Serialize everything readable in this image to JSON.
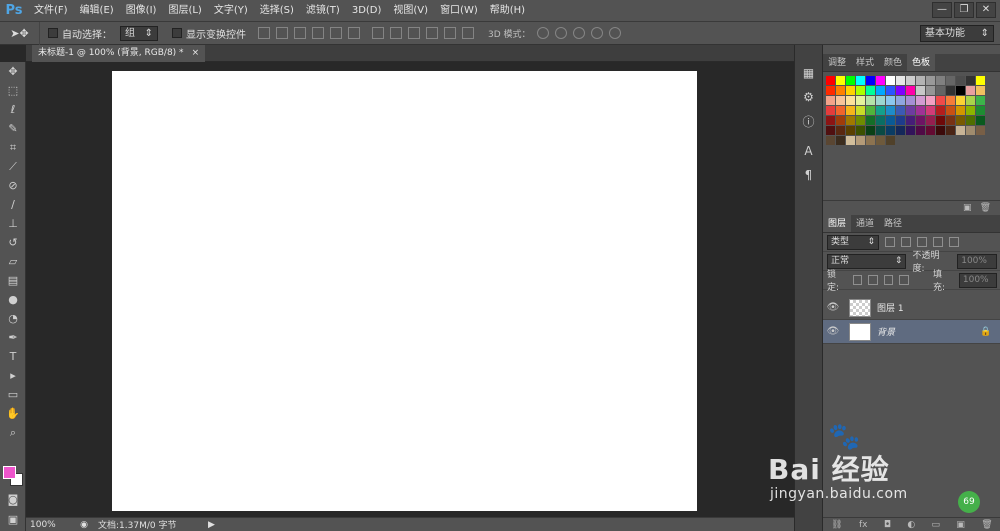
{
  "app": {
    "logo": "Ps"
  },
  "menu": [
    "文件(F)",
    "编辑(E)",
    "图像(I)",
    "图层(L)",
    "文字(Y)",
    "选择(S)",
    "滤镜(T)",
    "3D(D)",
    "视图(V)",
    "窗口(W)",
    "帮助(H)"
  ],
  "window_controls": {
    "minimize": "—",
    "restore": "❐",
    "close": "✕"
  },
  "options_bar": {
    "auto_select_label": "自动选择：",
    "auto_select_value": "组",
    "show_transform_label": "显示变换控件",
    "mode_3d_label": "3D 模式：",
    "workspace": "基本功能"
  },
  "document_tab": {
    "title": "未标题-1 @ 100% (背景, RGB/8) *",
    "close": "×"
  },
  "status_bar": {
    "zoom": "100%",
    "doc_info": "文档:1.37M/0 字节"
  },
  "top_panel": {
    "tabs": [
      "调整",
      "样式",
      "颜色",
      "色板"
    ],
    "active_tab": "色板",
    "swatch_colors": [
      "#ff0000",
      "#ffff00",
      "#00ff00",
      "#00ffff",
      "#0000ff",
      "#ff00ff",
      "#ffffff",
      "#e6e6e6",
      "#cccccc",
      "#b3b3b3",
      "#999999",
      "#808080",
      "#666666",
      "#4d4d4d",
      "#333333",
      "#ffff00",
      "#ff2a00",
      "#ff8000",
      "#ffd200",
      "#aaff00",
      "#00ff99",
      "#00a8ff",
      "#2a55ff",
      "#7f00ff",
      "#ff00aa",
      "#c8c8c8",
      "#969696",
      "#646464",
      "#323232",
      "#000000",
      "#e8a0a0",
      "#f0c060",
      "#f3a38a",
      "#f8c49a",
      "#fde19a",
      "#e6f39c",
      "#b4e3a8",
      "#9cd6d0",
      "#8cc7ee",
      "#8fa6e0",
      "#a68fd5",
      "#d39bd2",
      "#f2a0c3",
      "#f04a4a",
      "#f57c3a",
      "#fbd234",
      "#a8d44a",
      "#3cb44a",
      "#e43c3c",
      "#f0642c",
      "#f5b41a",
      "#c8dc28",
      "#50b43c",
      "#14a08c",
      "#1e8cc8",
      "#3c5ab4",
      "#6e3ca0",
      "#a03296",
      "#d23c78",
      "#b41e1e",
      "#c85014",
      "#d29600",
      "#8cb400",
      "#1e8c32",
      "#8c1414",
      "#a03c0a",
      "#a07800",
      "#6e8c00",
      "#146e28",
      "#0a6e64",
      "#0a5a96",
      "#1e3c8c",
      "#461e78",
      "#6e1464",
      "#961e50",
      "#6e0a0a",
      "#783214",
      "#785a00",
      "#506e00",
      "#0a5a1e",
      "#501010",
      "#5a2810",
      "#5a4000",
      "#3c5000",
      "#0a4016",
      "#0a4a44",
      "#0a3c64",
      "#14285a",
      "#32145a",
      "#500a46",
      "#640a32",
      "#3c0a0a",
      "#4a2414",
      "#c8b496",
      "#a08c6e",
      "#785f46",
      "#5a4632",
      "#3c2d1e",
      "#d2be9b",
      "#b49b78",
      "#8c7350",
      "#6e5a3c",
      "#50412a"
    ]
  },
  "layers_panel": {
    "tabs": [
      "图层",
      "通道",
      "路径"
    ],
    "active_tab": "图层",
    "filter_kind": "类型",
    "blend_mode": "正常",
    "opacity_label": "不透明度:",
    "opacity_value": "100%",
    "lock_label": "锁定:",
    "fill_label": "填充:",
    "fill_value": "100%",
    "layers": [
      {
        "name": "图层 1",
        "selected": false,
        "locked": false,
        "thumb": "checker"
      },
      {
        "name": "背景",
        "selected": true,
        "locked": true,
        "thumb": "white"
      }
    ]
  },
  "foreground_color": "#ee55cc",
  "background_color": "#ffffff",
  "watermark": {
    "brand": "Bai  经验",
    "url": "jingyan.baidu.com",
    "badge": "69"
  }
}
